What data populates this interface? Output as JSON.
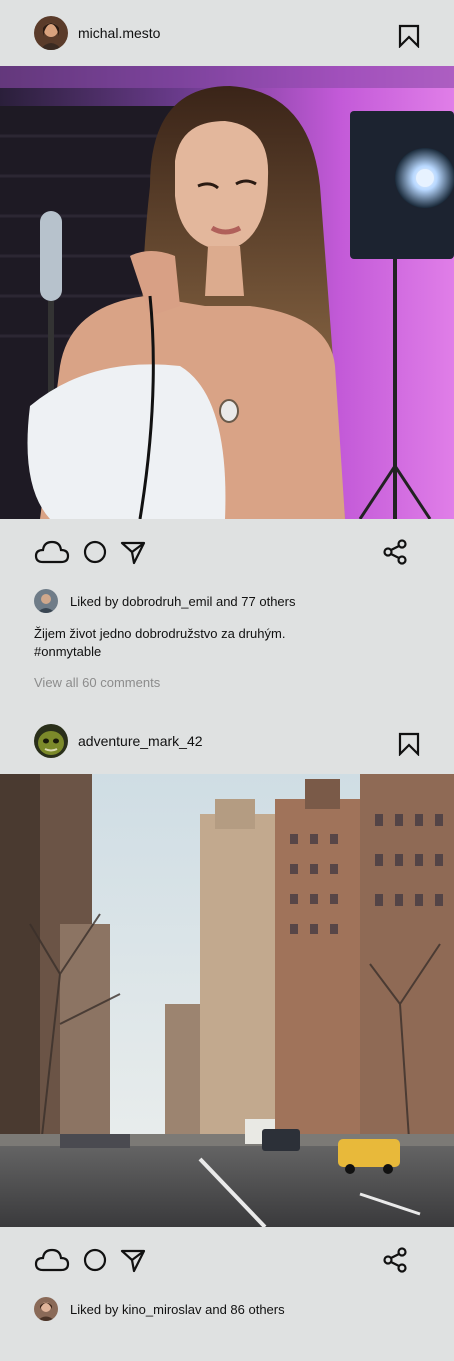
{
  "posts": [
    {
      "username": "michal.mesto",
      "likes_text": "Liked by dobrodruh_emil and 77 others",
      "caption_line1": "Žijem život jedno dobrodružstvo za druhým.",
      "caption_line2": "#onmytable",
      "view_comments": "View all 60 comments"
    },
    {
      "username": "adventure_mark_42",
      "likes_text": "Liked by kino_miroslav and 86 others"
    }
  ],
  "icons": {
    "save": "bookmark-icon",
    "like": "cloud-icon",
    "comment": "circle-icon",
    "send": "paper-plane-icon",
    "share": "share-icon"
  }
}
